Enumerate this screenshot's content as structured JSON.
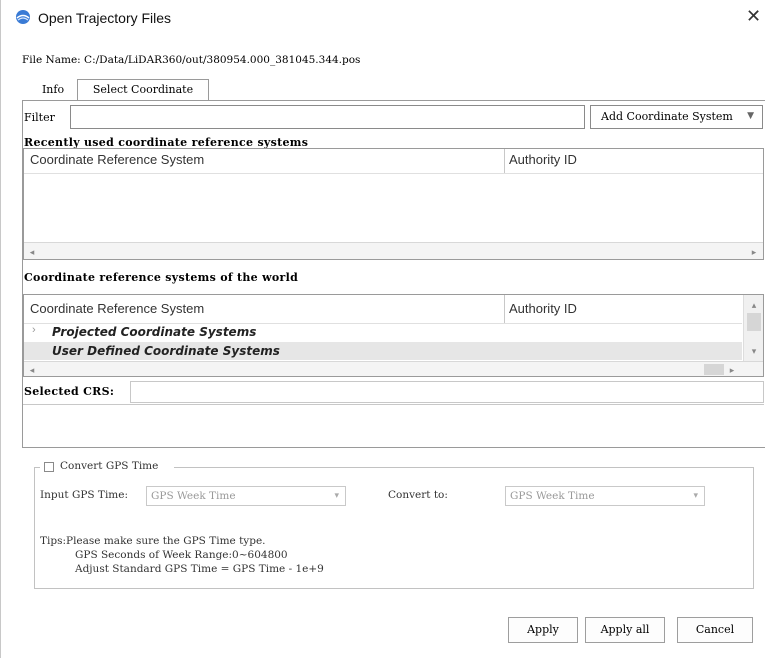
{
  "window": {
    "title": "Open Trajectory Files",
    "close_icon": "close-icon",
    "app_icon": "app-logo-icon"
  },
  "file_name": "File Name: C:/Data/LiDAR360/out/380954.000_381045.344.pos",
  "tabs": [
    {
      "label": "Info"
    },
    {
      "label": "Select Coordinate"
    }
  ],
  "filter": {
    "label": "Filter",
    "value": "",
    "add_button": "Add Coordinate System"
  },
  "recent": {
    "heading": "Recently used coordinate reference systems",
    "columns": [
      "Coordinate Reference System",
      "Authority ID"
    ],
    "rows": []
  },
  "world": {
    "heading": "Coordinate reference systems of the world",
    "columns": [
      "Coordinate Reference System",
      "Authority ID"
    ],
    "rows": [
      {
        "label": "Projected Coordinate Systems",
        "expandable": true
      },
      {
        "label": "User Defined Coordinate Systems",
        "expandable": false
      }
    ]
  },
  "selected_crs": {
    "label": "Selected CRS:",
    "value": ""
  },
  "gps": {
    "checkbox_label": "Convert GPS Time",
    "checked": false,
    "input_label": "Input GPS Time:",
    "input_value": "GPS Week Time",
    "convert_label": "Convert to:",
    "convert_value": "GPS Week Time",
    "tips_1": "Tips:Please make sure the GPS Time type.",
    "tips_2": "GPS Seconds of Week Range:0~604800",
    "tips_3": "Adjust Standard GPS Time = GPS Time - 1e+9"
  },
  "buttons": {
    "apply": "Apply",
    "apply_all": "Apply all",
    "cancel": "Cancel"
  }
}
